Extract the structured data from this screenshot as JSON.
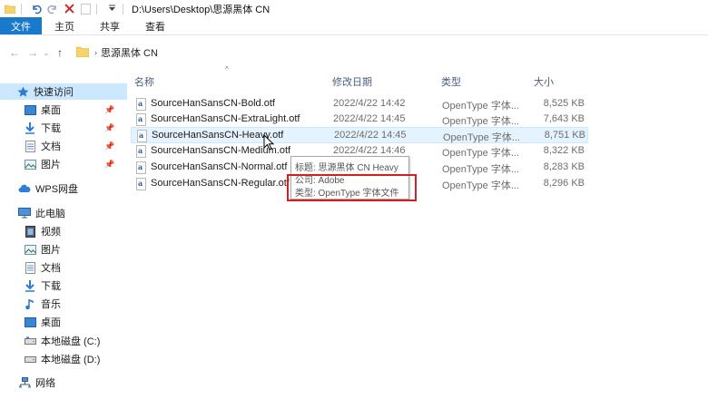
{
  "titlebar": {
    "path": "D:\\Users\\Desktop\\思源黑体 CN"
  },
  "ribbon": {
    "tabs": [
      {
        "label": "文件",
        "active": true
      },
      {
        "label": "主页",
        "active": false
      },
      {
        "label": "共享",
        "active": false
      },
      {
        "label": "查看",
        "active": false
      }
    ]
  },
  "address": {
    "crumb": "思源黑体 CN"
  },
  "sidebar": {
    "quick_access": "快速访问",
    "pinned": [
      {
        "label": "桌面",
        "icon": "desktop-icon"
      },
      {
        "label": "下载",
        "icon": "download-icon"
      },
      {
        "label": "文档",
        "icon": "document-icon"
      },
      {
        "label": "图片",
        "icon": "picture-icon"
      }
    ],
    "wps": "WPS网盘",
    "this_pc": "此电脑",
    "pc_items": [
      {
        "label": "视频",
        "icon": "video-icon"
      },
      {
        "label": "图片",
        "icon": "picture-icon"
      },
      {
        "label": "文档",
        "icon": "document-icon"
      },
      {
        "label": "下载",
        "icon": "download-icon"
      },
      {
        "label": "音乐",
        "icon": "music-icon"
      },
      {
        "label": "桌面",
        "icon": "desktop-icon"
      },
      {
        "label": "本地磁盘 (C:)",
        "icon": "drive-icon"
      },
      {
        "label": "本地磁盘 (D:)",
        "icon": "drive-icon"
      }
    ],
    "network": "网络"
  },
  "list": {
    "headers": {
      "name": "名称",
      "date": "修改日期",
      "type": "类型",
      "size": "大小"
    },
    "files": [
      {
        "name": "SourceHanSansCN-Bold.otf",
        "date": "2022/4/22 14:42",
        "type": "OpenType 字体...",
        "size": "8,525 KB"
      },
      {
        "name": "SourceHanSansCN-ExtraLight.otf",
        "date": "2022/4/22 14:45",
        "type": "OpenType 字体...",
        "size": "7,643 KB"
      },
      {
        "name": "SourceHanSansCN-Heavy.otf",
        "date": "2022/4/22 14:45",
        "type": "OpenType 字体...",
        "size": "8,751 KB"
      },
      {
        "name": "SourceHanSansCN-Medium.otf",
        "date": "2022/4/22 14:46",
        "type": "OpenType 字体...",
        "size": "8,322 KB"
      },
      {
        "name": "SourceHanSansCN-Normal.otf",
        "date": "",
        "type": "OpenType 字体...",
        "size": "8,283 KB"
      },
      {
        "name": "SourceHanSansCN-Regular.otf",
        "date": "",
        "type": "OpenType 字体...",
        "size": "8,296 KB"
      }
    ]
  },
  "tooltip": {
    "title": "标题: 思源黑体 CN Heavy",
    "company": "公司: Adobe",
    "type": "类型: OpenType 字体文件"
  },
  "colors": {
    "accent": "#1979ca",
    "selection": "#cce8ff",
    "hover": "#e5f3ff",
    "highlight_box": "#d21f1f"
  }
}
